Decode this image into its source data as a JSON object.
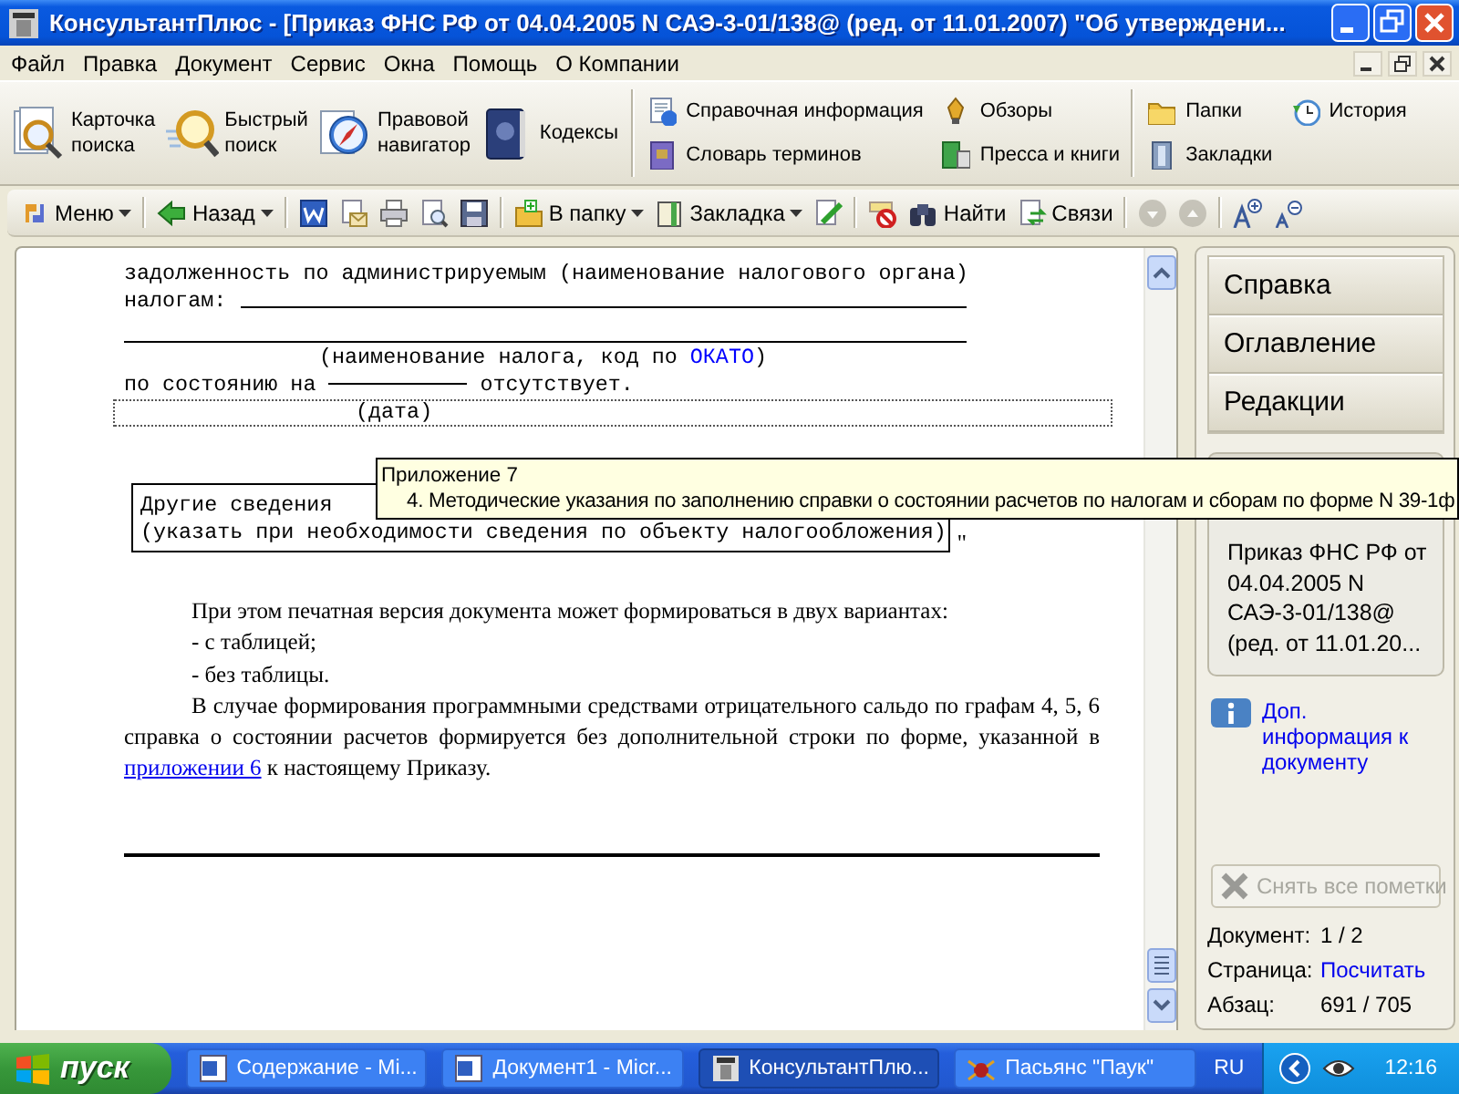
{
  "window": {
    "title": "КонсультантПлюс - [Приказ ФНС РФ от 04.04.2005 N САЭ-3-01/138@ (ред. от 11.01.2007) \"Об утверждени..."
  },
  "menu": [
    "Файл",
    "Правка",
    "Документ",
    "Сервис",
    "Окна",
    "Помощь",
    "О Компании"
  ],
  "big_toolbar": {
    "large_buttons": [
      {
        "label": "Карточка поиска"
      },
      {
        "label": "Быстрый поиск"
      },
      {
        "label": "Правовой навигатор"
      },
      {
        "label": "Кодексы"
      }
    ],
    "groups": [
      [
        {
          "label": "Справочная информация"
        },
        {
          "label": "Словарь терминов"
        },
        {
          "label": "Обзоры"
        },
        {
          "label": "Пресса и книги"
        }
      ],
      [
        {
          "label": "Папки"
        },
        {
          "label": "Закладки"
        },
        {
          "label": "История"
        }
      ]
    ]
  },
  "toolbar": [
    [
      {
        "label": "Меню",
        "dropdown": true,
        "disabled": false
      }
    ],
    [
      {
        "label": "Назад",
        "dropdown": true,
        "disabled": false
      }
    ],
    [
      {
        "dropdown": false,
        "disabled": false
      },
      {
        "dropdown": false,
        "disabled": false
      },
      {
        "dropdown": false,
        "disabled": false
      },
      {
        "dropdown": false,
        "disabled": false
      },
      {
        "dropdown": false,
        "disabled": false
      }
    ],
    [
      {
        "label": "В папку",
        "dropdown": true,
        "disabled": false
      },
      {
        "label": "Закладка",
        "dropdown": true,
        "disabled": false
      },
      {
        "dropdown": false,
        "disabled": false
      }
    ],
    [
      {
        "dropdown": false,
        "disabled": false
      },
      {
        "label": "Найти",
        "dropdown": false,
        "disabled": false
      },
      {
        "label": "Связи",
        "dropdown": false,
        "disabled": false
      }
    ],
    [
      {
        "dropdown": false,
        "disabled": true
      },
      {
        "dropdown": false,
        "disabled": true
      }
    ],
    [
      {
        "dropdown": false,
        "disabled": false
      },
      {
        "dropdown": false,
        "disabled": false
      }
    ]
  ],
  "document": {
    "line_1": "задолженность по администрируемым (наименование налогового органа)",
    "taxes_label": "налогам:",
    "tax_caption": "(наименование налога, код по ",
    "okato_link": "ОКАТО",
    "tax_caption_end": ")",
    "as_of": "по состоянию на",
    "absent": "отсутствует.",
    "date_caption": "(дата)",
    "other_box": {
      "title": "Другие сведения",
      "note": "(указать при необходимости сведения по объекту налогообложения)"
    },
    "closing_quote": "\"",
    "paragraphs": [
      {
        "text": "При этом печатная версия документа может формироваться в двух вариантах:"
      },
      {
        "text": "- с таблицей;"
      },
      {
        "text": "- без таблицы."
      },
      {
        "text": "В случае формирования программными средствами отрицательного сальдо по графам 4, 5, 6 справка о состоянии расчетов формируется без дополнительной строки по форме, указанной в ",
        "link": "приложении 6",
        "after": " к настоящему Приказу."
      }
    ]
  },
  "tooltip": {
    "title": "Приложение 7",
    "text": "4. Методические указания по заполнению справки о состоянии расчетов по налогам и сборам по форме N 39-1ф"
  },
  "side_panel": {
    "tabs": [
      {
        "label": "Справка",
        "selected": false
      },
      {
        "label": "Оглавление",
        "selected": false
      },
      {
        "label": "Редакции",
        "selected": false
      }
    ],
    "card_lines": [
      "Приказ ФНС РФ от",
      "04.04.2005 N",
      "САЭ-3-01/138@",
      "(ред. от 11.01.20..."
    ],
    "info_link": "Доп. информация к документу",
    "clear_button": {
      "label": "Снять все пометки",
      "disabled": true
    },
    "status": [
      {
        "label": "Документ:",
        "value": "1 / 2",
        "kind": "text"
      },
      {
        "label": "Страница:",
        "value": "Посчитать",
        "kind": "link"
      },
      {
        "label": "Абзац:",
        "value": "691 / 705",
        "kind": "text"
      }
    ]
  },
  "taskbar": {
    "start": "пуск",
    "tasks": [
      {
        "label": "Содержание - Mi...",
        "selected": false
      },
      {
        "label": "Документ1 - Micr...",
        "selected": false
      },
      {
        "label": "КонсультантПлю...",
        "selected": true
      },
      {
        "label": "Пасьянс \"Паук\"",
        "selected": false
      }
    ],
    "language": "RU",
    "clock": "12:16"
  }
}
